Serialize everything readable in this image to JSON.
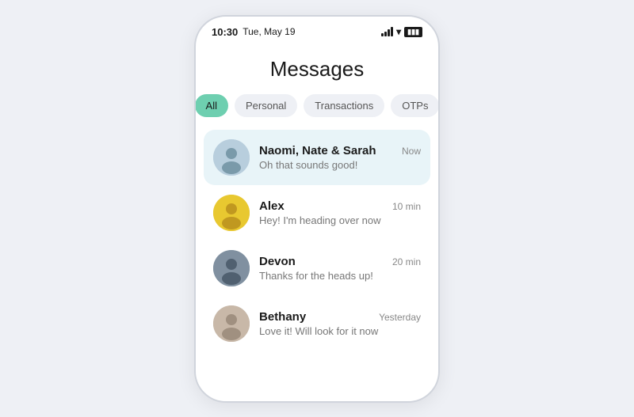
{
  "statusBar": {
    "time": "10:30",
    "date": "Tue, May 19"
  },
  "pageTitle": "Messages",
  "filters": [
    {
      "id": "all",
      "label": "All",
      "active": true
    },
    {
      "id": "personal",
      "label": "Personal",
      "active": false
    },
    {
      "id": "transactions",
      "label": "Transactions",
      "active": false
    },
    {
      "id": "otps",
      "label": "OTPs",
      "active": false
    }
  ],
  "messages": [
    {
      "id": "naomi",
      "name": "Naomi, Nate & Sarah",
      "preview": "Oh that sounds good!",
      "time": "Now",
      "highlighted": true,
      "avatarEmoji": "🧑‍🤝‍🧑"
    },
    {
      "id": "alex",
      "name": "Alex",
      "preview": "Hey! I'm heading over now",
      "time": "10 min",
      "highlighted": false,
      "avatarEmoji": "👩"
    },
    {
      "id": "devon",
      "name": "Devon",
      "preview": "Thanks for the heads up!",
      "time": "20 min",
      "highlighted": false,
      "avatarEmoji": "👨"
    },
    {
      "id": "bethany",
      "name": "Bethany",
      "preview": "Love it! Will look for it now",
      "time": "Yesterday",
      "highlighted": false,
      "avatarEmoji": "👩‍🦱"
    }
  ]
}
